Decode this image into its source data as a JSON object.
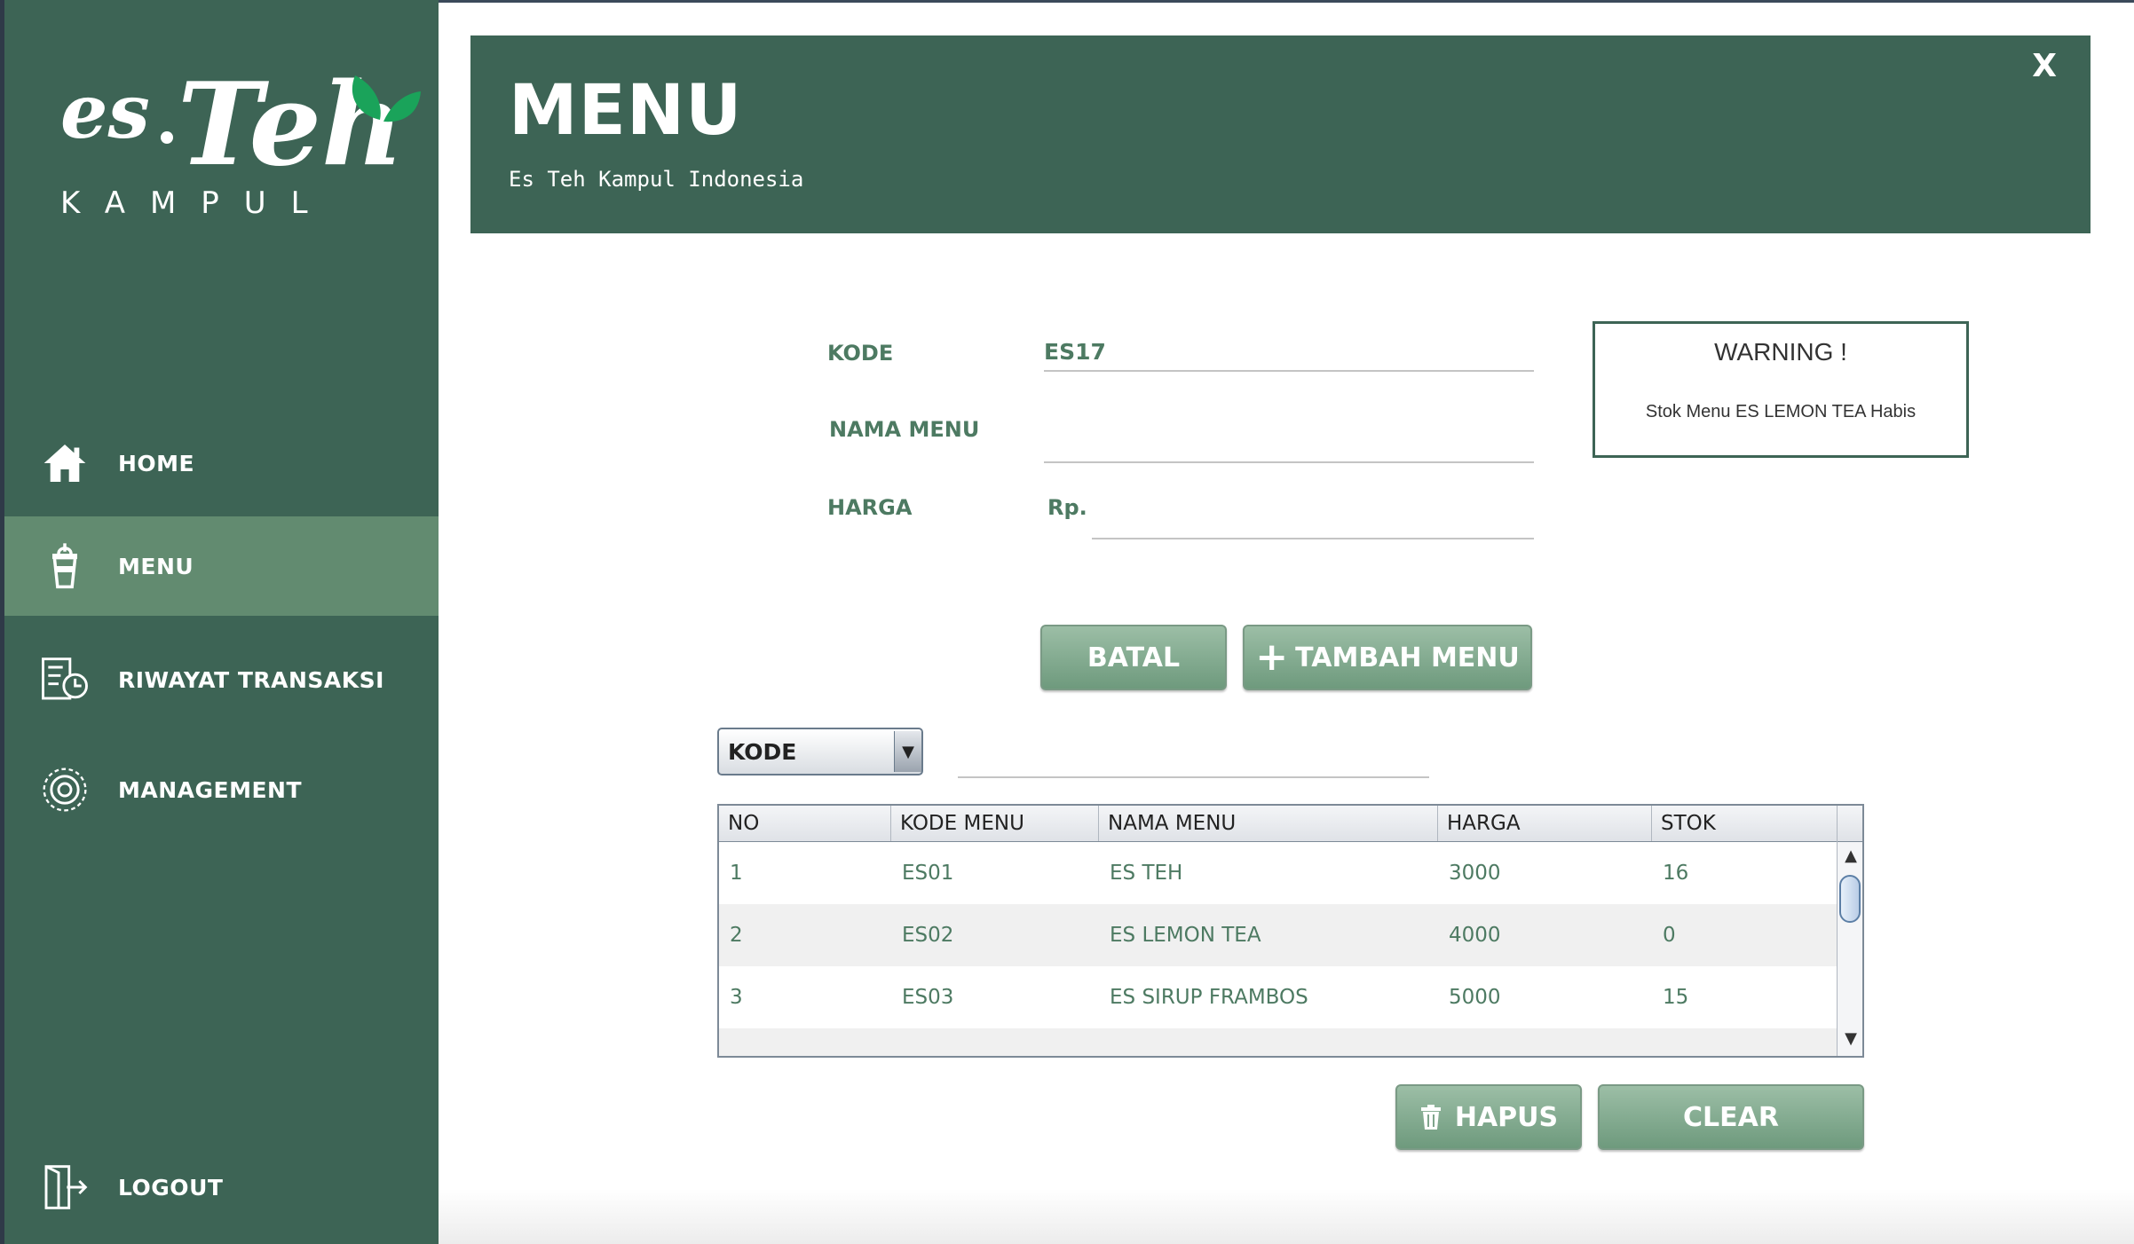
{
  "app": {
    "logo": {
      "word1": "es",
      "dot": ".",
      "word2": "Teh",
      "word3": "KAMPUL"
    }
  },
  "sidebar": {
    "items": [
      {
        "label": "HOME",
        "icon": "home-icon"
      },
      {
        "label": "MENU",
        "icon": "cup-icon",
        "active": true
      },
      {
        "label": "RIWAYAT TRANSAKSI",
        "icon": "history-icon"
      },
      {
        "label": "MANAGEMENT",
        "icon": "gear-icon"
      },
      {
        "label": "LOGOUT",
        "icon": "logout-icon"
      }
    ]
  },
  "header": {
    "title": "MENU",
    "subtitle": "Es Teh Kampul Indonesia",
    "close": "X"
  },
  "form": {
    "kode_label": "KODE",
    "kode_value": "ES17",
    "nama_label": "NAMA MENU",
    "nama_value": "",
    "harga_label": "HARGA",
    "harga_prefix": "Rp.",
    "harga_value": ""
  },
  "warning": {
    "title": "WARNING !",
    "text": "Stok Menu ES LEMON TEA Habis"
  },
  "buttons": {
    "batal": "BATAL",
    "tambah": "TAMBAH MENU",
    "hapus": "HAPUS",
    "clear": "CLEAR"
  },
  "filter": {
    "selected": "KODE",
    "search_value": ""
  },
  "table": {
    "columns": [
      "NO",
      "KODE MENU",
      "NAMA MENU",
      "HARGA",
      "STOK"
    ],
    "rows": [
      [
        "1",
        "ES01",
        "ES TEH",
        "3000",
        "16"
      ],
      [
        "2",
        "ES02",
        "ES LEMON TEA",
        "4000",
        "0"
      ],
      [
        "3",
        "ES03",
        "ES SIRUP FRAMBOS",
        "5000",
        "15"
      ]
    ]
  },
  "colors": {
    "primary": "#3d6455",
    "active": "#628b70",
    "text_green": "#4d7a62"
  }
}
